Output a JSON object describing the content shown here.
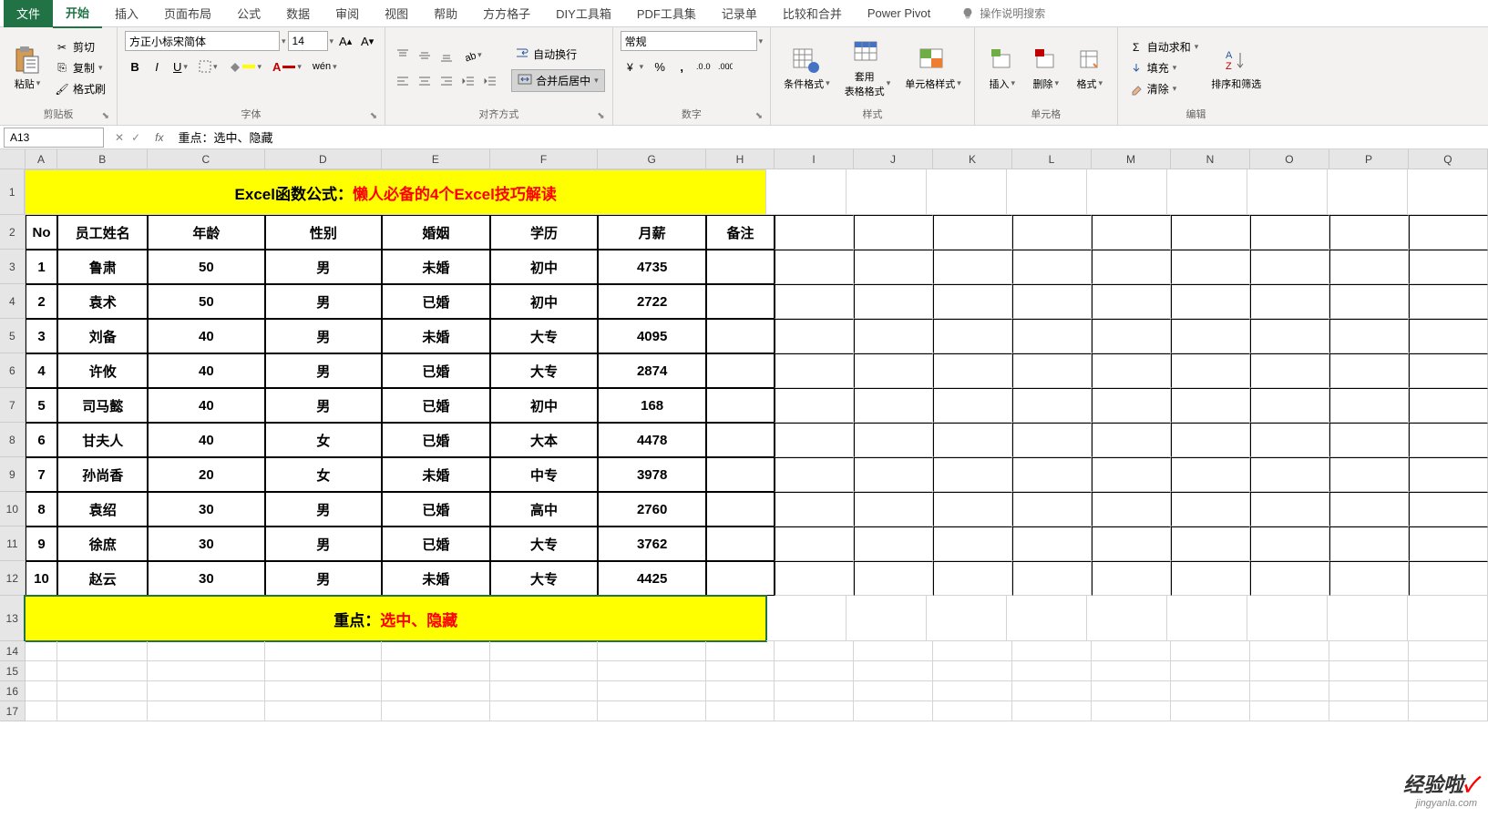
{
  "tabs": {
    "file": "文件",
    "home": "开始",
    "insert": "插入",
    "layout": "页面布局",
    "formulas": "公式",
    "data": "数据",
    "review": "审阅",
    "view": "视图",
    "help": "帮助",
    "fangfang": "方方格子",
    "diy": "DIY工具箱",
    "pdf": "PDF工具集",
    "record": "记录单",
    "compare": "比较和合并",
    "pivot": "Power Pivot",
    "tellme": "操作说明搜索"
  },
  "clipboard": {
    "paste": "粘贴",
    "cut": "剪切",
    "copy": "复制",
    "format_painter": "格式刷",
    "group": "剪贴板"
  },
  "font": {
    "name": "方正小标宋简体",
    "size": "14",
    "group": "字体"
  },
  "alignment": {
    "wrap": "自动换行",
    "merge": "合并后居中",
    "group": "对齐方式"
  },
  "number": {
    "format": "常规",
    "group": "数字"
  },
  "styles": {
    "conditional": "条件格式",
    "table": "套用\n表格格式",
    "cell": "单元格样式",
    "group": "样式"
  },
  "cells": {
    "insert": "插入",
    "delete": "删除",
    "format": "格式",
    "group": "单元格"
  },
  "editing": {
    "autosum": "自动求和",
    "fill": "填充",
    "clear": "清除",
    "sort": "排序和筛选",
    "group": "编辑"
  },
  "namebox": "A13",
  "formula": "重点：选中、隐藏",
  "cols": [
    "A",
    "B",
    "C",
    "D",
    "E",
    "F",
    "G",
    "H",
    "I",
    "J",
    "K",
    "L",
    "M",
    "N",
    "O",
    "P",
    "Q"
  ],
  "title_black": "Excel函数公式：",
  "title_red": "懒人必备的4个Excel技巧解读",
  "headers": [
    "No",
    "员工姓名",
    "年龄",
    "性别",
    "婚姻",
    "学历",
    "月薪",
    "备注"
  ],
  "rows": [
    [
      "1",
      "鲁肃",
      "50",
      "男",
      "未婚",
      "初中",
      "4735",
      ""
    ],
    [
      "2",
      "袁术",
      "50",
      "男",
      "已婚",
      "初中",
      "2722",
      ""
    ],
    [
      "3",
      "刘备",
      "40",
      "男",
      "未婚",
      "大专",
      "4095",
      ""
    ],
    [
      "4",
      "许攸",
      "40",
      "男",
      "已婚",
      "大专",
      "2874",
      ""
    ],
    [
      "5",
      "司马懿",
      "40",
      "男",
      "已婚",
      "初中",
      "168",
      ""
    ],
    [
      "6",
      "甘夫人",
      "40",
      "女",
      "已婚",
      "大本",
      "4478",
      ""
    ],
    [
      "7",
      "孙尚香",
      "20",
      "女",
      "未婚",
      "中专",
      "3978",
      ""
    ],
    [
      "8",
      "袁绍",
      "30",
      "男",
      "已婚",
      "高中",
      "2760",
      ""
    ],
    [
      "9",
      "徐庶",
      "30",
      "男",
      "已婚",
      "大专",
      "3762",
      ""
    ],
    [
      "10",
      "赵云",
      "30",
      "男",
      "未婚",
      "大专",
      "4425",
      ""
    ]
  ],
  "footer_black": "重点：",
  "footer_red": "选中、隐藏",
  "watermark": {
    "main": "经验啦",
    "sub": "jingyanla.com"
  }
}
